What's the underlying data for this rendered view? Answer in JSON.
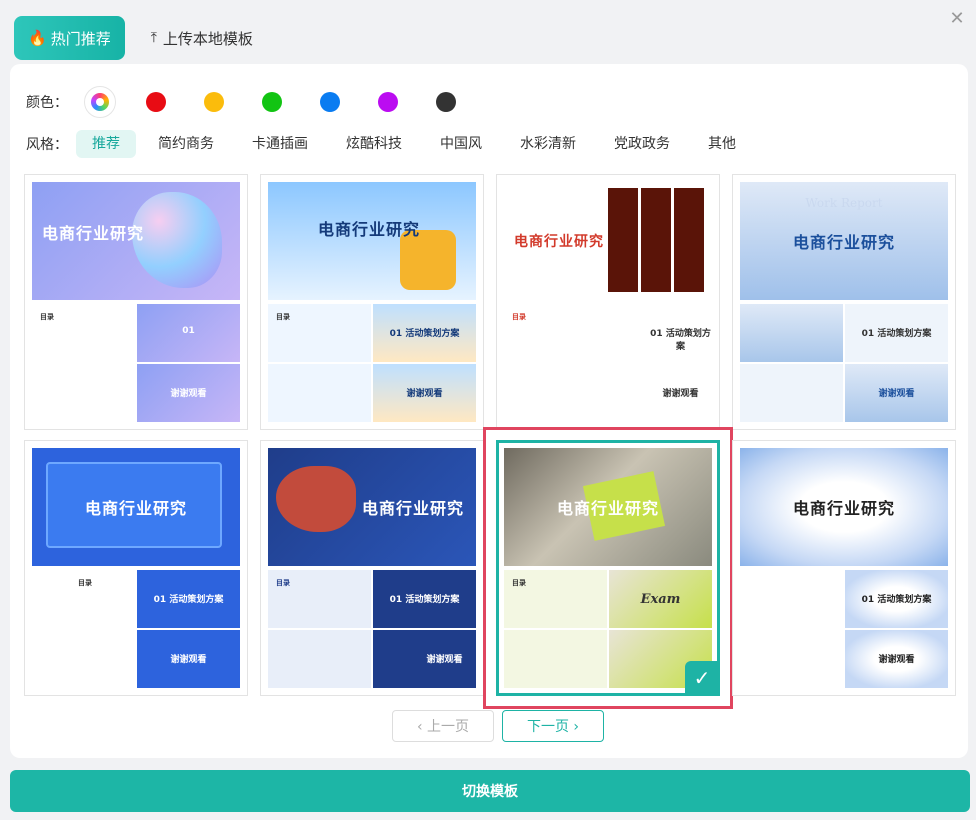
{
  "tabs": {
    "hot_label": "热门推荐",
    "upload_label": "上传本地模板"
  },
  "filters": {
    "color_label": "颜色：",
    "colors": [
      "all",
      "#e80c14",
      "#fbbc0c",
      "#12c413",
      "#0a7cf1",
      "#bb0cf1",
      "#333333"
    ],
    "style_label": "风格：",
    "styles": [
      "推荐",
      "简约商务",
      "卡通插画",
      "炫酷科技",
      "中国风",
      "水彩清新",
      "党政政务",
      "其他"
    ],
    "active_style": "推荐"
  },
  "templates": [
    {
      "title": "电商行业研究",
      "slide1": "目录",
      "slide2": "01",
      "slide4": "谢谢观看"
    },
    {
      "title": "电商行业研究",
      "slide1": "目录",
      "slide2": "01 活动策划方案",
      "slide4": "谢谢观看"
    },
    {
      "title": "电商行业研究",
      "slide1": "目录",
      "slide2": "01 活动策划方案",
      "slide4": "谢谢观看"
    },
    {
      "title": "电商行业研究",
      "overline": "Work Report",
      "slide1": "",
      "slide2": "01 活动策划方案",
      "slide4": "谢谢观看"
    },
    {
      "title": "电商行业研究",
      "slide1": "目录",
      "slide2": "01 活动策划方案",
      "slide4": "谢谢观看"
    },
    {
      "title": "电商行业研究",
      "slide1": "目录",
      "slide2": "01 活动策划方案",
      "slide4": "谢谢观看"
    },
    {
      "title": "电商行业研究",
      "slide1": "目录",
      "slide2": "Exam",
      "slide4": ""
    },
    {
      "title": "电商行业研究",
      "slide1": "",
      "slide2": "01 活动策划方案",
      "slide4": "谢谢观看"
    }
  ],
  "selected_template_index": 6,
  "pager": {
    "prev_label": "上一页",
    "next_label": "下一页"
  },
  "switch_label": "切换模板"
}
